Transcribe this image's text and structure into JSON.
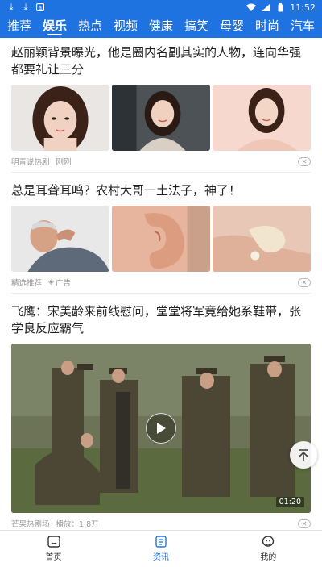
{
  "status_bar": {
    "left_icons": [
      "download-icon",
      "download-icon",
      "app-icon"
    ],
    "right_icons": [
      "wifi-icon",
      "signal-icon",
      "battery-icon"
    ],
    "time": "11:52"
  },
  "tabs": [
    {
      "label": "推荐",
      "active": false
    },
    {
      "label": "娱乐",
      "active": true
    },
    {
      "label": "热点",
      "active": false
    },
    {
      "label": "视频",
      "active": false
    },
    {
      "label": "健康",
      "active": false
    },
    {
      "label": "搞笑",
      "active": false
    },
    {
      "label": "母婴",
      "active": false
    },
    {
      "label": "时尚",
      "active": false
    },
    {
      "label": "汽车",
      "active": false
    }
  ],
  "articles": [
    {
      "title": "赵丽颖背景曝光，他是圈内名副其实的人物，连向华强都要礼让三分",
      "source": "明青说热剧",
      "time": "刚刚",
      "ad": ""
    },
    {
      "title": "总是耳聋耳鸣？农村大哥一土法子，神了！",
      "source": "精选推荐",
      "ad": "广告"
    },
    {
      "title": "飞鹰：宋美龄来前线慰问，堂堂将军竟给她系鞋带，张学良反应霸气",
      "source": "芒果热剧场",
      "plays": "播放：1.8万",
      "duration": "01:20"
    }
  ],
  "bottom_nav": [
    {
      "label": "首页",
      "icon": "home-icon",
      "active": false
    },
    {
      "label": "资讯",
      "icon": "news-icon",
      "active": true
    },
    {
      "label": "我的",
      "icon": "profile-icon",
      "active": false
    }
  ],
  "colors": {
    "brand": "#1f73e0",
    "meta_text": "#999999"
  }
}
